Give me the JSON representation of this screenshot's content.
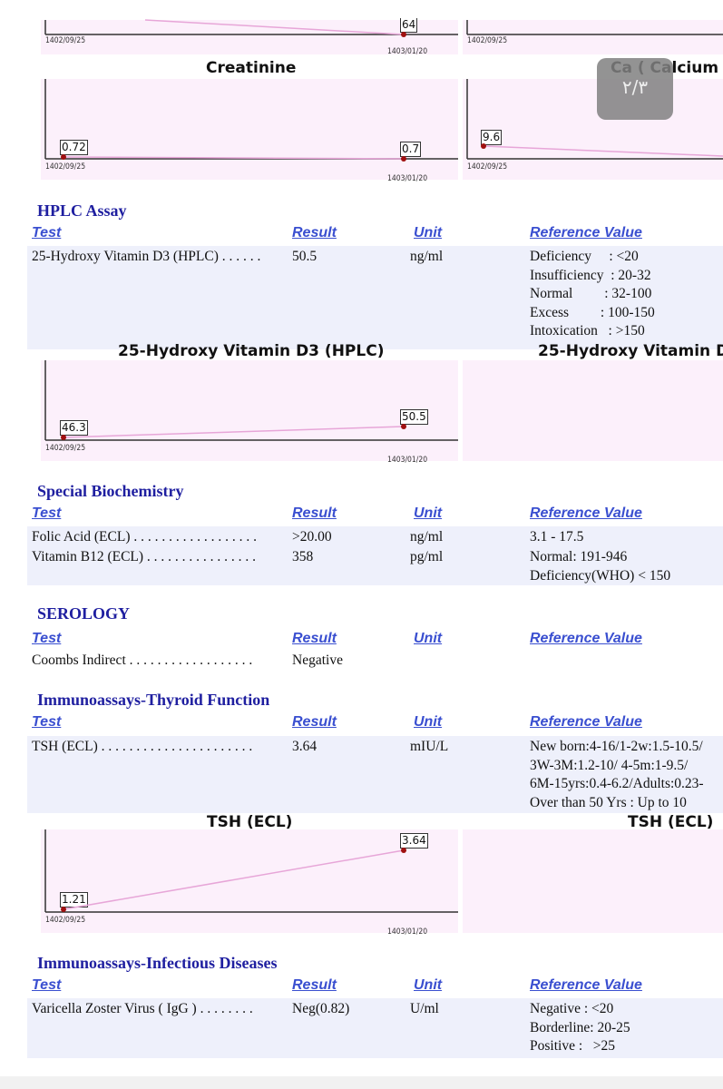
{
  "charts": {
    "top": {
      "label_end": "64",
      "date_start": "1402/09/25",
      "date_end": "1403/01/20",
      "right_date_start": "1402/09/25"
    },
    "creatinine": {
      "title": "Creatinine",
      "values": [
        0.72,
        0.7
      ],
      "labels": [
        "0.72",
        "0.7"
      ],
      "dates": [
        "1402/09/25",
        "1403/01/20"
      ]
    },
    "calcium": {
      "title": "Ca ( Calcium",
      "values": [
        9.6
      ],
      "labels": [
        "9.6"
      ],
      "dates": [
        "1402/09/25"
      ]
    },
    "vitd": {
      "title": "25-Hydroxy Vitamin D3 (HPLC)",
      "right_title": "25-Hydroxy Vitamin D",
      "values": [
        46.3,
        50.5
      ],
      "labels": [
        "46.3",
        "50.5"
      ],
      "dates": [
        "1402/09/25",
        "1403/01/20"
      ]
    },
    "tsh": {
      "title": "TSH (ECL)",
      "right_title": "TSH (ECL)",
      "values": [
        1.21,
        3.64
      ],
      "labels": [
        "1.21",
        "3.64"
      ],
      "dates": [
        "1402/09/25",
        "1403/01/20"
      ]
    }
  },
  "page_badge": "٢/٣",
  "headers": {
    "test": "Test",
    "result": "Result",
    "unit": "Unit",
    "ref": "Reference Value"
  },
  "sections": {
    "hplc": {
      "title": "HPLC Assay",
      "rows": [
        {
          "test": "25-Hydroxy Vitamin D3 (HPLC) . . . . . .",
          "result": "50.5",
          "unit": "ng/ml",
          "ref": [
            "Deficiency     : <20",
            "Insufficiency  : 20-32",
            "Normal         : 32-100",
            "Excess         : 100-150",
            "Intoxication   : >150"
          ]
        }
      ]
    },
    "special": {
      "title": "Special Biochemistry",
      "rows": [
        {
          "test": "Folic Acid (ECL) . . . . . . . . . . . . . . . . . .",
          "result": ">20.00",
          "unit": "ng/ml",
          "ref": [
            "3.1 - 17.5"
          ]
        },
        {
          "test": "Vitamin B12 (ECL) . . . . . . . . . . . . . . . .",
          "result": "358",
          "unit": "pg/ml",
          "ref": [
            "Normal: 191-946",
            "Deficiency(WHO) < 150"
          ]
        }
      ]
    },
    "serology": {
      "title": "SEROLOGY",
      "rows": [
        {
          "test": "Coombs Indirect . . . . . . . . . . . . . . . . . .",
          "result": "Negative",
          "unit": "",
          "ref": []
        }
      ]
    },
    "thyroid": {
      "title": "Immunoassays-Thyroid Function",
      "rows": [
        {
          "test": "TSH (ECL) . . . . . . . . . . . . . . . . . . . . . .",
          "result": "3.64",
          "unit": "mIU/L",
          "ref": [
            "New born:4-16/1-2w:1.5-10.5/",
            "3W-3M:1.2-10/ 4-5m:1-9.5/",
            "6M-15yrs:0.4-6.2/Adults:0.23-",
            "Over than 50 Yrs : Up to 10"
          ]
        }
      ]
    },
    "infectious": {
      "title": "Immunoassays-Infectious Diseases",
      "rows": [
        {
          "test": "Varicella Zoster Virus ( IgG ) . . . . . . . .",
          "result": "Neg(0.82)",
          "unit": "U/ml",
          "ref": [
            "Negative : <20",
            "Borderline: 20-25",
            "Positive :   >25"
          ]
        }
      ]
    }
  },
  "colors": {
    "section": "#1f1fa0",
    "header": "#3a4fd0",
    "row_bg": "#eef0fb",
    "chart_bg": "#fcf0fb",
    "line": "#e7a6d8",
    "point": "#a01010"
  }
}
